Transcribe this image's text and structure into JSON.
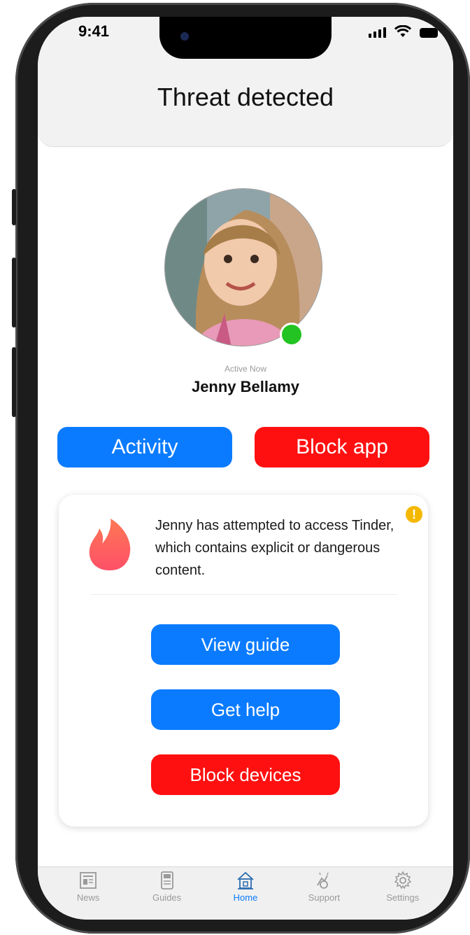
{
  "status_bar": {
    "time": "9:41"
  },
  "header": {
    "title": "Threat detected"
  },
  "profile": {
    "status": "Active Now",
    "name": "Jenny Bellamy"
  },
  "actions": {
    "activity": "Activity",
    "block_app": "Block app"
  },
  "alert": {
    "message": "Jenny has attempted to access Tinder, which contains explicit or dangerous content.",
    "warning_symbol": "!",
    "buttons": {
      "view_guide": "View guide",
      "get_help": "Get help",
      "block_devices": "Block devices"
    }
  },
  "tabs": [
    {
      "label": "News",
      "icon": "news-icon"
    },
    {
      "label": "Guides",
      "icon": "guides-icon"
    },
    {
      "label": "Home",
      "icon": "home-icon",
      "active": true
    },
    {
      "label": "Support",
      "icon": "support-icon"
    },
    {
      "label": "Settings",
      "icon": "gear-icon"
    }
  ],
  "colors": {
    "primary": "#0a7bff",
    "danger": "#ff1010",
    "online": "#22c322",
    "warning": "#f5b800"
  }
}
